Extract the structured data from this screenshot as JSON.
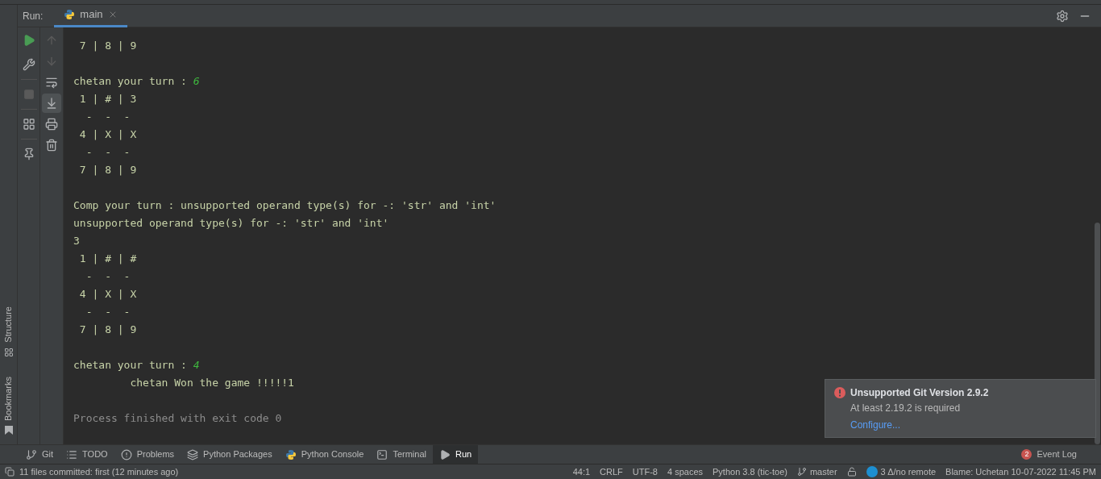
{
  "run_bar": {
    "label": "Run:",
    "tabs": [
      {
        "label": "main",
        "selected": true
      }
    ]
  },
  "console": {
    "lines": [
      {
        "kind": "output",
        "text": " 7 | 8 | 9"
      },
      {
        "kind": "blank"
      },
      {
        "kind": "output",
        "text": "chetan your turn : ",
        "input": "6"
      },
      {
        "kind": "output",
        "text": " 1 | # | 3"
      },
      {
        "kind": "output",
        "text": "  -  -  -"
      },
      {
        "kind": "output",
        "text": " 4 | X | X"
      },
      {
        "kind": "output",
        "text": "  -  -  -"
      },
      {
        "kind": "output",
        "text": " 7 | 8 | 9"
      },
      {
        "kind": "blank"
      },
      {
        "kind": "output",
        "text": "Comp your turn : unsupported operand type(s) for -: 'str' and 'int'"
      },
      {
        "kind": "output",
        "text": "unsupported operand type(s) for -: 'str' and 'int'"
      },
      {
        "kind": "output",
        "text": "3"
      },
      {
        "kind": "output",
        "text": " 1 | # | #"
      },
      {
        "kind": "output",
        "text": "  -  -  -"
      },
      {
        "kind": "output",
        "text": " 4 | X | X"
      },
      {
        "kind": "output",
        "text": "  -  -  -"
      },
      {
        "kind": "output",
        "text": " 7 | 8 | 9"
      },
      {
        "kind": "blank"
      },
      {
        "kind": "output",
        "text": "chetan your turn : ",
        "input": "4"
      },
      {
        "kind": "output",
        "text": "         chetan Won the game !!!!!1"
      },
      {
        "kind": "blank"
      },
      {
        "kind": "system",
        "text": "Process finished with exit code 0"
      }
    ]
  },
  "side_panels": [
    "Structure",
    "Bookmarks"
  ],
  "notification": {
    "title": "Unsupported Git Version 2.9.2",
    "message": "At least 2.19.2 is required",
    "link": "Configure..."
  },
  "tool_tabs": [
    {
      "kind": "git",
      "label": "Git",
      "selected": false
    },
    {
      "kind": "todo",
      "label": "TODO",
      "selected": false
    },
    {
      "kind": "problems",
      "label": "Problems",
      "selected": false
    },
    {
      "kind": "packages",
      "label": "Python Packages",
      "selected": false
    },
    {
      "kind": "console",
      "label": "Python Console",
      "selected": false
    },
    {
      "kind": "terminal",
      "label": "Terminal",
      "selected": false
    },
    {
      "kind": "run",
      "label": "Run",
      "selected": true
    }
  ],
  "event_log": {
    "count": "2",
    "label": "Event Log"
  },
  "status_bar": {
    "message": "11 files committed: first (12 minutes ago)",
    "position": "44:1",
    "line_ending": "CRLF",
    "encoding": "UTF-8",
    "indent": "4 spaces",
    "interpreter": "Python 3.8 (tic-toe)",
    "branch": "master",
    "changes": "3 Δ/no remote",
    "blame": "Blame: Uchetan 10-07-2022 11:45 PM"
  }
}
